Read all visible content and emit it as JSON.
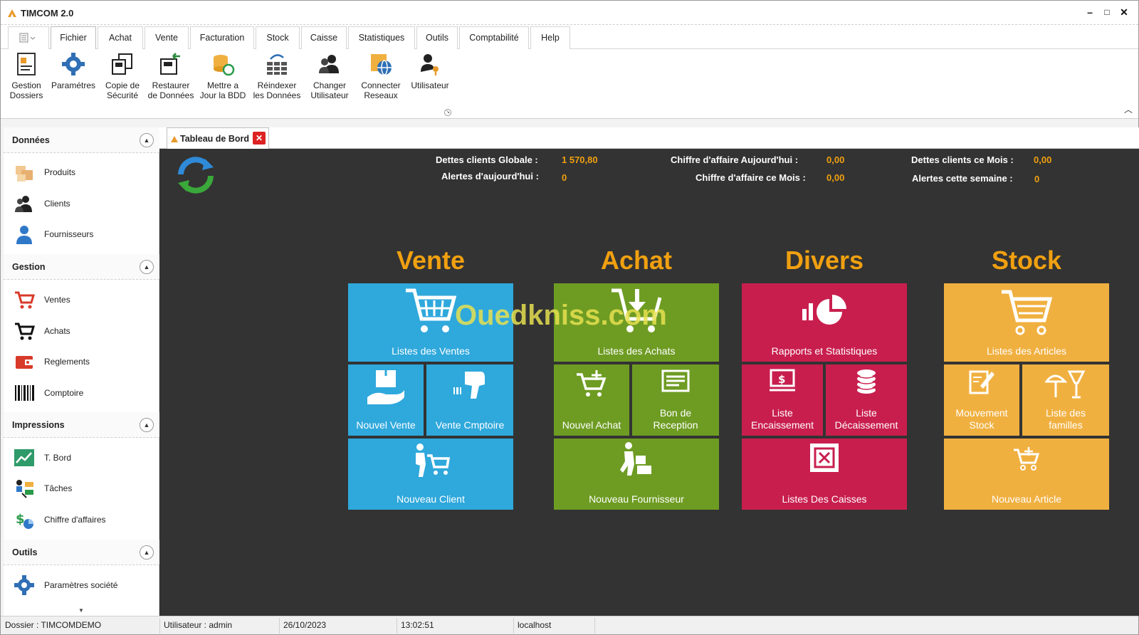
{
  "app": {
    "title": "TIMCOM 2.0"
  },
  "window_controls": {
    "minimize": "–",
    "maximize": "□",
    "close": "✕"
  },
  "menu": {
    "tabs": [
      "Fichier",
      "Achat",
      "Vente",
      "Facturation",
      "Stock",
      "Caisse",
      "Statistiques",
      "Outils",
      "Comptabilité",
      "Help"
    ],
    "active": "Fichier"
  },
  "ribbon": {
    "buttons": [
      {
        "label": "Gestion\nDossiers",
        "icon": "folder-doc-icon"
      },
      {
        "label": "Paramétres",
        "icon": "gear-icon"
      },
      {
        "label": "Copie de\nSécurité",
        "icon": "backup-icon"
      },
      {
        "label": "Restaurer\nde Données",
        "icon": "restore-icon"
      },
      {
        "label": "Mettre a\nJour la BDD",
        "icon": "database-update-icon"
      },
      {
        "label": "Réindexer\nles Données",
        "icon": "reindex-icon"
      },
      {
        "label": "Changer\nUtilisateur",
        "icon": "users-icon"
      },
      {
        "label": "Connecter\nReseaux",
        "icon": "network-icon"
      },
      {
        "label": "Utilisateur",
        "icon": "user-key-icon"
      }
    ]
  },
  "sidebar": {
    "sections": [
      {
        "title": "Données",
        "items": [
          {
            "label": "Produits",
            "icon": "products-icon"
          },
          {
            "label": "Clients",
            "icon": "clients-icon"
          },
          {
            "label": "Fournisseurs",
            "icon": "supplier-icon"
          }
        ]
      },
      {
        "title": "Gestion",
        "items": [
          {
            "label": "Ventes",
            "icon": "cart-red-icon"
          },
          {
            "label": "Achats",
            "icon": "cart-black-icon"
          },
          {
            "label": "Reglements",
            "icon": "wallet-icon"
          },
          {
            "label": "Comptoire",
            "icon": "barcode-icon"
          }
        ]
      },
      {
        "title": "Impressions",
        "items": [
          {
            "label": "T. Bord",
            "icon": "chart-up-icon"
          },
          {
            "label": "Tâches",
            "icon": "tasks-icon"
          },
          {
            "label": "Chiffre d'affaires",
            "icon": "money-chart-icon"
          }
        ]
      },
      {
        "title": "Outils",
        "items": [
          {
            "label": "Paramètres société",
            "icon": "gear-icon"
          }
        ]
      }
    ]
  },
  "doc_tab": {
    "label": "Tableau de Bord",
    "close": "✕"
  },
  "stats": {
    "dettes_globale_label": "Dettes clients Globale :",
    "dettes_globale_value": "1 570,80",
    "alertes_jour_label": "Alertes d'aujourd'hui :",
    "alertes_jour_value": "0",
    "ca_jour_label": "Chiffre d'affaire Aujourd'hui :",
    "ca_jour_value": "0,00",
    "ca_mois_label": "Chiffre d'affaire ce Mois :",
    "ca_mois_value": "0,00",
    "dettes_mois_label": "Dettes clients ce Mois :",
    "dettes_mois_value": "0,00",
    "alertes_semaine_label": "Alertes cette semaine :",
    "alertes_semaine_value": "0"
  },
  "sections": {
    "vente": {
      "title": "Vente",
      "color": "#f0a010",
      "tile_color": "#2fa8dc",
      "tiles": {
        "liste": "Listes des Ventes",
        "nouvel": "Nouvel Vente",
        "comptoire": "Vente Cmptoire",
        "client": "Nouveau Client"
      }
    },
    "achat": {
      "title": "Achat",
      "color": "#f0a010",
      "tile_color": "#6e9c23",
      "tiles": {
        "liste": "Listes des Achats",
        "nouvel": "Nouvel Achat",
        "bon": "Bon de\nReception",
        "fournisseur": "Nouveau Fournisseur"
      }
    },
    "divers": {
      "title": "Divers",
      "color": "#f0a010",
      "tile_color": "#c81e4e",
      "tiles": {
        "rapports": "Rapports et Statistiques",
        "encaissement": "Liste\nEncaissement",
        "decaissement": "Liste\nDécaissement",
        "caisses": "Listes Des Caisses"
      }
    },
    "stock": {
      "title": "Stock",
      "color": "#f0a010",
      "tile_color": "#f0b040",
      "tiles": {
        "articles": "Listes des Articles",
        "mouvement": "Mouvement\nStock",
        "familles": "Liste des\nfamilles",
        "nouvel": "Nouveau Article"
      }
    }
  },
  "watermark": "Ouedkniss.com",
  "status": {
    "dossier": "Dossier : TIMCOMDEMO",
    "utilisateur": "Utilisateur : admin",
    "date": "26/10/2023",
    "time": "13:02:51",
    "server": "localhost"
  }
}
